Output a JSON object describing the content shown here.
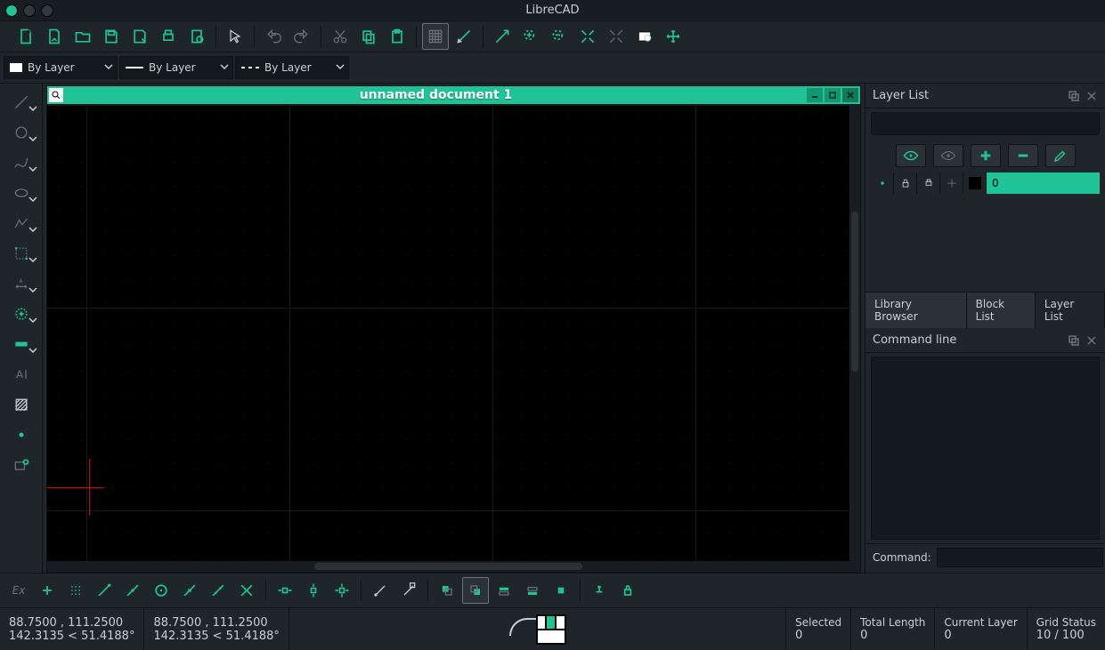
{
  "window": {
    "title": "LibreCAD"
  },
  "document": {
    "title": "unnamed document 1"
  },
  "combos": {
    "color": "By Layer",
    "width": "By Layer",
    "linetype": "By Layer"
  },
  "layer_panel": {
    "title": "Layer List",
    "tabs": {
      "library": "Library Browser",
      "block": "Block List",
      "layer": "Layer List"
    },
    "layers": [
      {
        "name": "0",
        "color": "#000000"
      }
    ]
  },
  "command_line": {
    "title": "Command line",
    "prompt": "Command:"
  },
  "status": {
    "abs_xy": "88.7500 , 111.2500",
    "abs_polar": "142.3135 < 51.4188°",
    "rel_xy": "88.7500 , 111.2500",
    "rel_polar": "142.3135 < 51.4188°",
    "selected_label": "Selected",
    "selected_value": "0",
    "total_len_label": "Total Length",
    "total_len_value": "0",
    "current_layer_label": "Current Layer",
    "current_layer_value": "0",
    "grid_label": "Grid Status",
    "grid_value": "10 / 100"
  },
  "snapbar": {
    "ex_label": "Ex"
  }
}
